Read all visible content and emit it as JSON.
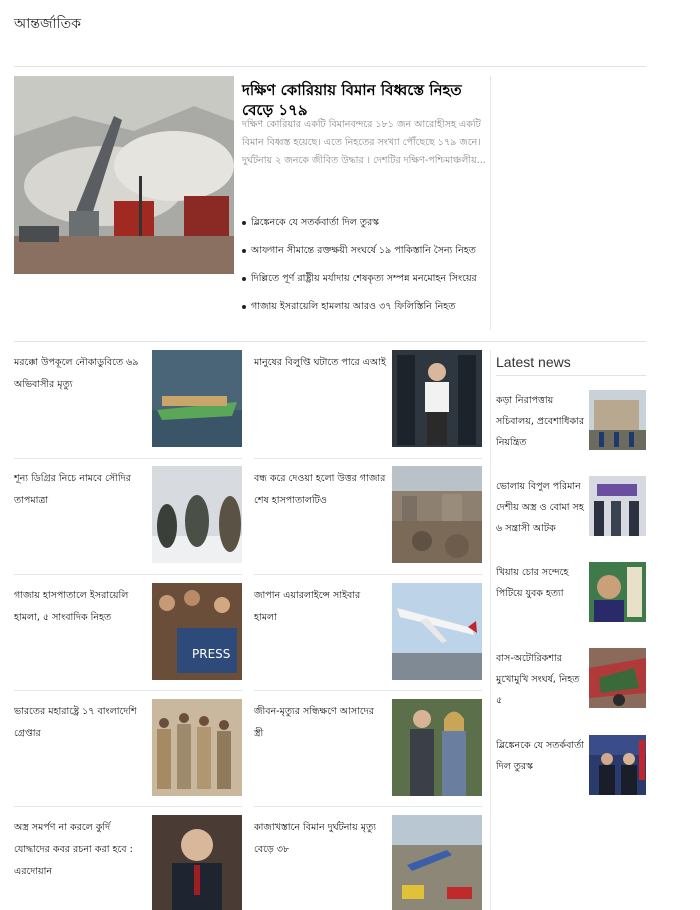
{
  "section": {
    "title": "আন্তর্জাতিক"
  },
  "lead": {
    "title": "দক্ষিণ কোরিয়ায় বিমান বিধ্বস্তে নিহত বেড়ে ১৭৯",
    "summary": "দক্ষিণ কোরিয়ার একটি বিমানবন্দরে ১৮১ জন আরোহীসহ একটি বিমান বিধ্বস্ত হয়েছে। এতে নিহতের সংখ্যা পৌঁছেছে ১৭৯ জনে। দুর্ঘটনায় ২ জনকে জীবিত উদ্ধার । দেশটির দক্ষিণ-পশ্চিমাঞ্চলীয়...",
    "bullets": [
      "ব্লিঙ্কেনকে যে সতর্কবার্তা দিল তুরস্ক",
      "আফগান সীমান্তে রক্তক্ষয়ী সংঘর্ষে ১৯ পাকিস্তানি সৈন্য নিহত",
      "দিল্লিতে পূর্ণ রাষ্ট্রীয় মর্যাদায় শেষকৃত্য সম্পন্ন মনমোহন সিংয়ের",
      "গাজায় ইসরায়েলি হামলায় আরও ৩৭ ফিলিস্তিনি নিহত"
    ]
  },
  "grid": [
    {
      "title": "মরক্কো উপকূলে নৌকাডুবিতে ৬৯ অভিবাসীর মৃত্যু",
      "icon": "boat-photo"
    },
    {
      "title": "মানুষের বিলুপ্তি ঘটাতে পারে এআই",
      "icon": "person-server-photo"
    },
    {
      "title": "শূন্য ডিগ্রির নিচে নামবে সৌদির তাপমাত্রা",
      "icon": "snow-people-photo"
    },
    {
      "title": "বন্ধ করে দেওয়া হলো উত্তর গাজার শেষ হাসপাতালটিও",
      "icon": "rubble-photo"
    },
    {
      "title": "গাজায় হাসপাতালে ইসরায়েলি হামলা, ৫ সাংবাদিক নিহত",
      "icon": "press-crowd-photo"
    },
    {
      "title": "জাপান এয়ারলাইন্সে সাইবার হামলা",
      "icon": "airplane-photo"
    },
    {
      "title": "ভারতের মহারাষ্ট্রে ১৭ বাংলাদেশি গ্রেপ্তার",
      "icon": "police-photo"
    },
    {
      "title": "জীবন-মৃত্যুর সন্ধিক্ষণে আসাদের স্ত্রী",
      "icon": "couple-photo"
    },
    {
      "title": "অস্ত্র সমর্পণ না করলে কুর্দি যোদ্ধাদের কবর রচনা করা হবে : এরদোয়ান",
      "icon": "leader-photo"
    },
    {
      "title": "কাজাখস্তানে বিমান দুর্ঘটনায় মৃত্যু বেড়ে ৩৮",
      "icon": "crash-site-photo"
    }
  ],
  "latest": {
    "title": "Latest news",
    "items": [
      {
        "title": "কড়া নিরাপত্তায় সচিবালয়, প্রবেশাধিকার নিয়ন্ত্রিত",
        "icon": "secretariat-photo"
      },
      {
        "title": "ভোলায় বিপুল পরিমান দেশীয় অস্ত্র ও বোমা সহ ৬ সন্ত্রাসী আটক",
        "icon": "arrest-photo"
      },
      {
        "title": "খিয়ায় চোর সন্দেহে পিটিয়ে যুবক হত্যা",
        "icon": "youth-photo"
      },
      {
        "title": "বাস-অটোরিকশার মুখোমুখি সংঘর্ষ, নিহত ৫",
        "icon": "wreck-photo"
      },
      {
        "title": "ব্লিঙ্কেনকে যে সতর্কবার্তা দিল তুরস্ক",
        "icon": "diplomats-photo"
      }
    ]
  }
}
